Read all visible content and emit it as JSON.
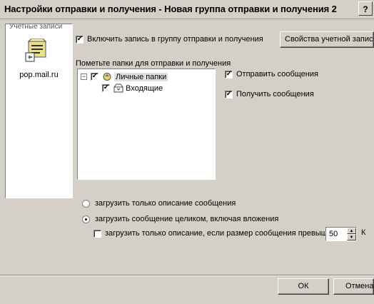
{
  "window": {
    "title": "Настройки отправки и получения - Новая группа отправки и получения 2",
    "help_label": "?"
  },
  "accounts": {
    "header": "Учетные записи",
    "items": [
      {
        "label": "pop.mail.ru",
        "icon": "account-icon"
      }
    ]
  },
  "include_checkbox": {
    "label": "Включить запись в группу отправки и получения",
    "checked": true
  },
  "account_properties_button": "Свойства учетной записи...",
  "folders": {
    "label": "Пометьте папки для отправки и получения",
    "tree": [
      {
        "label": "Личные папки",
        "expander": "−",
        "checked": true,
        "icon": "personal-folders-icon"
      },
      {
        "label": "Входящие",
        "checked": true,
        "icon": "inbox-icon"
      }
    ]
  },
  "send_messages": {
    "label": "Отправить сообщения",
    "checked": true
  },
  "receive_messages": {
    "label": "Получить сообщения",
    "checked": true
  },
  "download_options": {
    "headers_only": {
      "label": "загрузить только описание сообщения",
      "selected": false
    },
    "full": {
      "label": "загрузить сообщение целиком, включая вложения",
      "selected": true
    },
    "size_limit": {
      "label": "загрузить только описание, если размер сообщения превышает",
      "checked": false,
      "value": "50",
      "unit": "К"
    }
  },
  "buttons": {
    "ok": "ОК",
    "cancel": "Отмена"
  }
}
